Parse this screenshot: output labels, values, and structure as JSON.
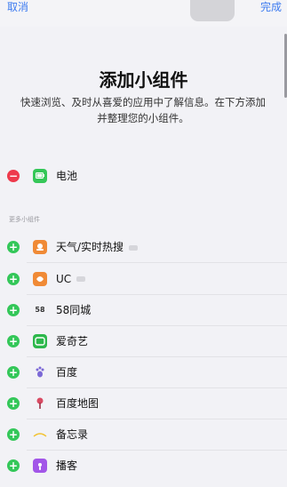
{
  "nav": {
    "cancel": "取消",
    "done": "完成"
  },
  "header": {
    "title": "添加小组件",
    "subtitle": "快速浏览、及时从喜爱的应用中了解信息。在下方添加并整理您的小组件。"
  },
  "current_widgets": [
    {
      "name": "电池",
      "icon": "battery-icon"
    }
  ],
  "more_section_label": "更多小组件",
  "more_widgets": [
    {
      "name": "天气/实时热搜",
      "icon": "weather-app-icon",
      "has_sub_icon": true
    },
    {
      "name": "UC",
      "icon": "uc-browser-icon",
      "has_sub_icon": true
    },
    {
      "name": "58同城",
      "icon": "58-tongcheng-icon",
      "icon_text": "58"
    },
    {
      "name": "爱奇艺",
      "icon": "iqiyi-icon"
    },
    {
      "name": "百度",
      "icon": "baidu-paw-icon"
    },
    {
      "name": "百度地图",
      "icon": "baidu-map-pin-icon"
    },
    {
      "name": "备忘录",
      "icon": "notes-icon"
    },
    {
      "name": "播客",
      "icon": "podcasts-icon"
    }
  ],
  "colors": {
    "accent": "#3d7bf0",
    "remove": "#ee3a4c",
    "add": "#34c759"
  }
}
